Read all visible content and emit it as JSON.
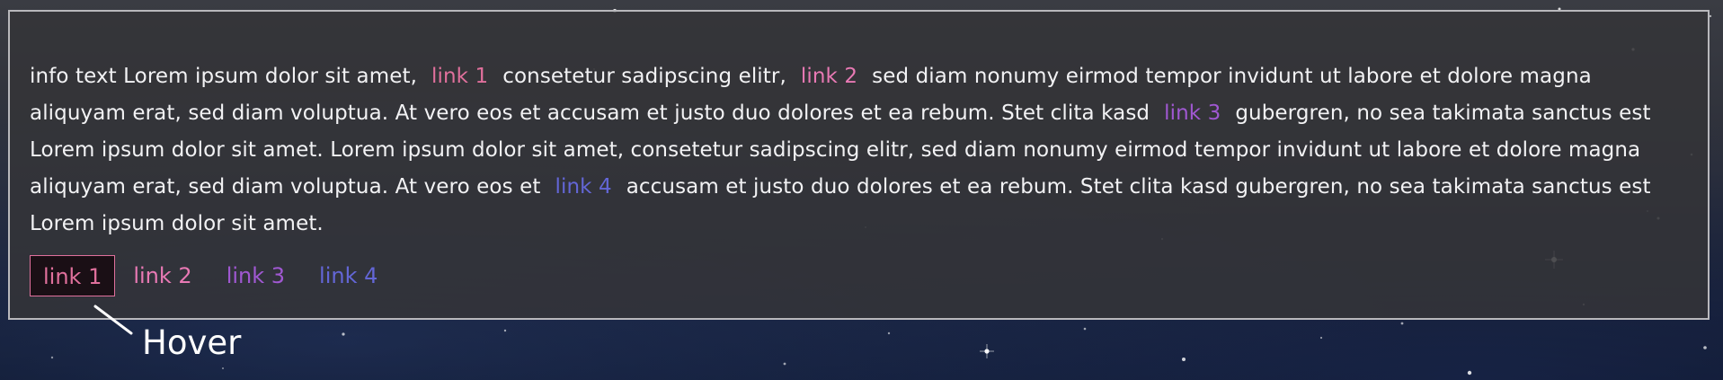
{
  "paragraph": {
    "seg1": "info text Lorem ipsum dolor sit amet,",
    "link1": "link 1",
    "seg2": "consetetur sadipscing elitr,",
    "link2": "link 2",
    "seg3": "sed diam nonumy eirmod tempor invidunt ut labore et dolore magna aliquyam erat, sed diam voluptua. At vero eos et accusam et justo duo dolores et ea rebum. Stet clita kasd",
    "link3": "link 3",
    "seg4": "gubergren, no sea takimata sanctus est Lorem ipsum dolor sit amet. Lorem ipsum dolor sit amet, consetetur sadipscing elitr, sed diam nonumy eirmod tempor invidunt ut labore et dolore magna aliquyam erat, sed diam voluptua. At vero eos et",
    "link4": "link 4",
    "seg5": "accusam et justo duo dolores et ea rebum. Stet clita kasd gubergren, no sea takimata sanctus est Lorem ipsum dolor sit amet."
  },
  "link_row": [
    "link 1",
    "link 2",
    "link 3",
    "link 4"
  ],
  "hover_state": {
    "hovered_link": "link 1",
    "callout_label": "Hover"
  },
  "colors": {
    "link1": "#e0709c",
    "link2": "#e879b4",
    "link3": "#a058d2",
    "link4": "#6366d6",
    "hover_background": "#1a0f15",
    "panel_border": "#b8b8bc",
    "text": "#f2f2f4"
  }
}
